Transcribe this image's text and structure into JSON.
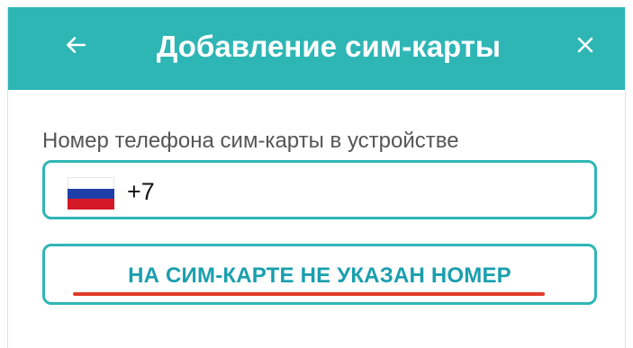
{
  "header": {
    "title": "Добавление сим-карты",
    "background_color": "#2eb6b5",
    "back_icon": "arrow-left-icon",
    "close_icon": "close-icon"
  },
  "form": {
    "phone_label": "Номер телефона сим-карты в устройстве",
    "country_flag": "russia-flag-icon",
    "phone_prefix": "+7",
    "accent_color": "#2eb6b5"
  },
  "status": {
    "message": "НА СИМ-КАРТЕ НЕ УКАЗАН НОМЕР",
    "underline_color": "#e23a2a"
  }
}
